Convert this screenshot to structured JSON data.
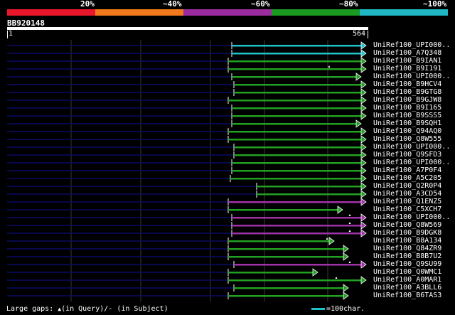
{
  "identity_scale": [
    {
      "label": "20%",
      "color": "#e8172b"
    },
    {
      "label": "~40%",
      "color": "#f07a1c"
    },
    {
      "label": "~60%",
      "color": "#9b2c9f"
    },
    {
      "label": "~80%",
      "color": "#1a9a20"
    },
    {
      "label": "~100%",
      "color": "#1fb7c4"
    }
  ],
  "query": {
    "name": "BB920148",
    "start": "1",
    "end": "564"
  },
  "colors": {
    "background": "#000000",
    "grid": "#3a3a3a",
    "query_line": "#0a0a66",
    "gap_marker": "#ffffff",
    "cyan": "#1fc2c9",
    "green": "#22a022",
    "purple": "#a032a8"
  },
  "hits": [
    {
      "label": "UniRef100_UPI000..",
      "color": "cyan"
    },
    {
      "label": "UniRef100_A7Q348",
      "color": "cyan"
    },
    {
      "label": "UniRef100_B9IAN1",
      "color": "green"
    },
    {
      "label": "UniRef100_B9I191",
      "color": "green"
    },
    {
      "label": "UniRef100_UPI000..",
      "color": "green"
    },
    {
      "label": "UniRef100_B9HCV4",
      "color": "green"
    },
    {
      "label": "UniRef100_B9GTG8",
      "color": "green"
    },
    {
      "label": "UniRef100_B9GJW8",
      "color": "green"
    },
    {
      "label": "UniRef100_B9I165",
      "color": "green"
    },
    {
      "label": "UniRef100_B9SSS5",
      "color": "green"
    },
    {
      "label": "UniRef100_B9SQH1",
      "color": "green"
    },
    {
      "label": "UniRef100_Q94AQ0",
      "color": "green"
    },
    {
      "label": "UniRef100_Q8W555",
      "color": "green"
    },
    {
      "label": "UniRef100_UPI000..",
      "color": "green"
    },
    {
      "label": "UniRef100_Q9SFD3",
      "color": "green"
    },
    {
      "label": "UniRef100_UPI000..",
      "color": "green"
    },
    {
      "label": "UniRef100_A7P0F4",
      "color": "green"
    },
    {
      "label": "UniRef100_A5C205",
      "color": "green"
    },
    {
      "label": "UniRef100_Q2R0P4",
      "color": "green"
    },
    {
      "label": "UniRef100_A3CD54",
      "color": "green"
    },
    {
      "label": "UniRef100_Q1ENZ5",
      "color": "purple"
    },
    {
      "label": "UniRef100_C5XCH7",
      "color": "green"
    },
    {
      "label": "UniRef100_UPI000..",
      "color": "purple"
    },
    {
      "label": "UniRef100_Q8W569",
      "color": "purple"
    },
    {
      "label": "UniRef100_B9DGK8",
      "color": "purple"
    },
    {
      "label": "UniRef100_B8A134",
      "color": "green"
    },
    {
      "label": "UniRef100_Q84ZR9",
      "color": "green"
    },
    {
      "label": "UniRef100_B8B7U2",
      "color": "green"
    },
    {
      "label": "UniRef100_Q9SU99",
      "color": "purple"
    },
    {
      "label": "UniRef100_Q0WMC1",
      "color": "green"
    },
    {
      "label": "UniRef100_A0MAR1",
      "color": "green"
    },
    {
      "label": "UniRef100_A3BLL6",
      "color": "green"
    },
    {
      "label": "UniRef100_B6TAS3",
      "color": "green"
    }
  ],
  "footer": {
    "legend_prefix": "Large gaps: ",
    "gap_symbol": "▲",
    "legend_suffix": "(in Query)/- (in Subject)",
    "scale_label": "=100char."
  }
}
